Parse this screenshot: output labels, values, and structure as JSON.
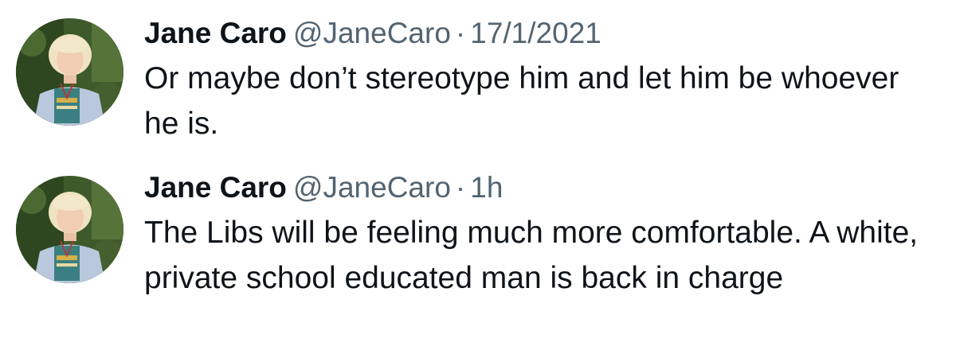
{
  "tweets": [
    {
      "display_name": "Jane Caro",
      "handle": "@JaneCaro",
      "separator": "·",
      "timestamp": "17/1/2021",
      "text": "Or maybe don’t stereotype him and let him be whoever he is.",
      "avatar_icon": "profile-photo"
    },
    {
      "display_name": "Jane Caro",
      "handle": "@JaneCaro",
      "separator": "·",
      "timestamp": "1h",
      "text": "The Libs will be feeling much more comfortable. A white, private school educated man is back in charge",
      "avatar_icon": "profile-photo"
    }
  ],
  "colors": {
    "text_primary": "#0f1419",
    "text_secondary": "#536471",
    "background": "#ffffff"
  }
}
